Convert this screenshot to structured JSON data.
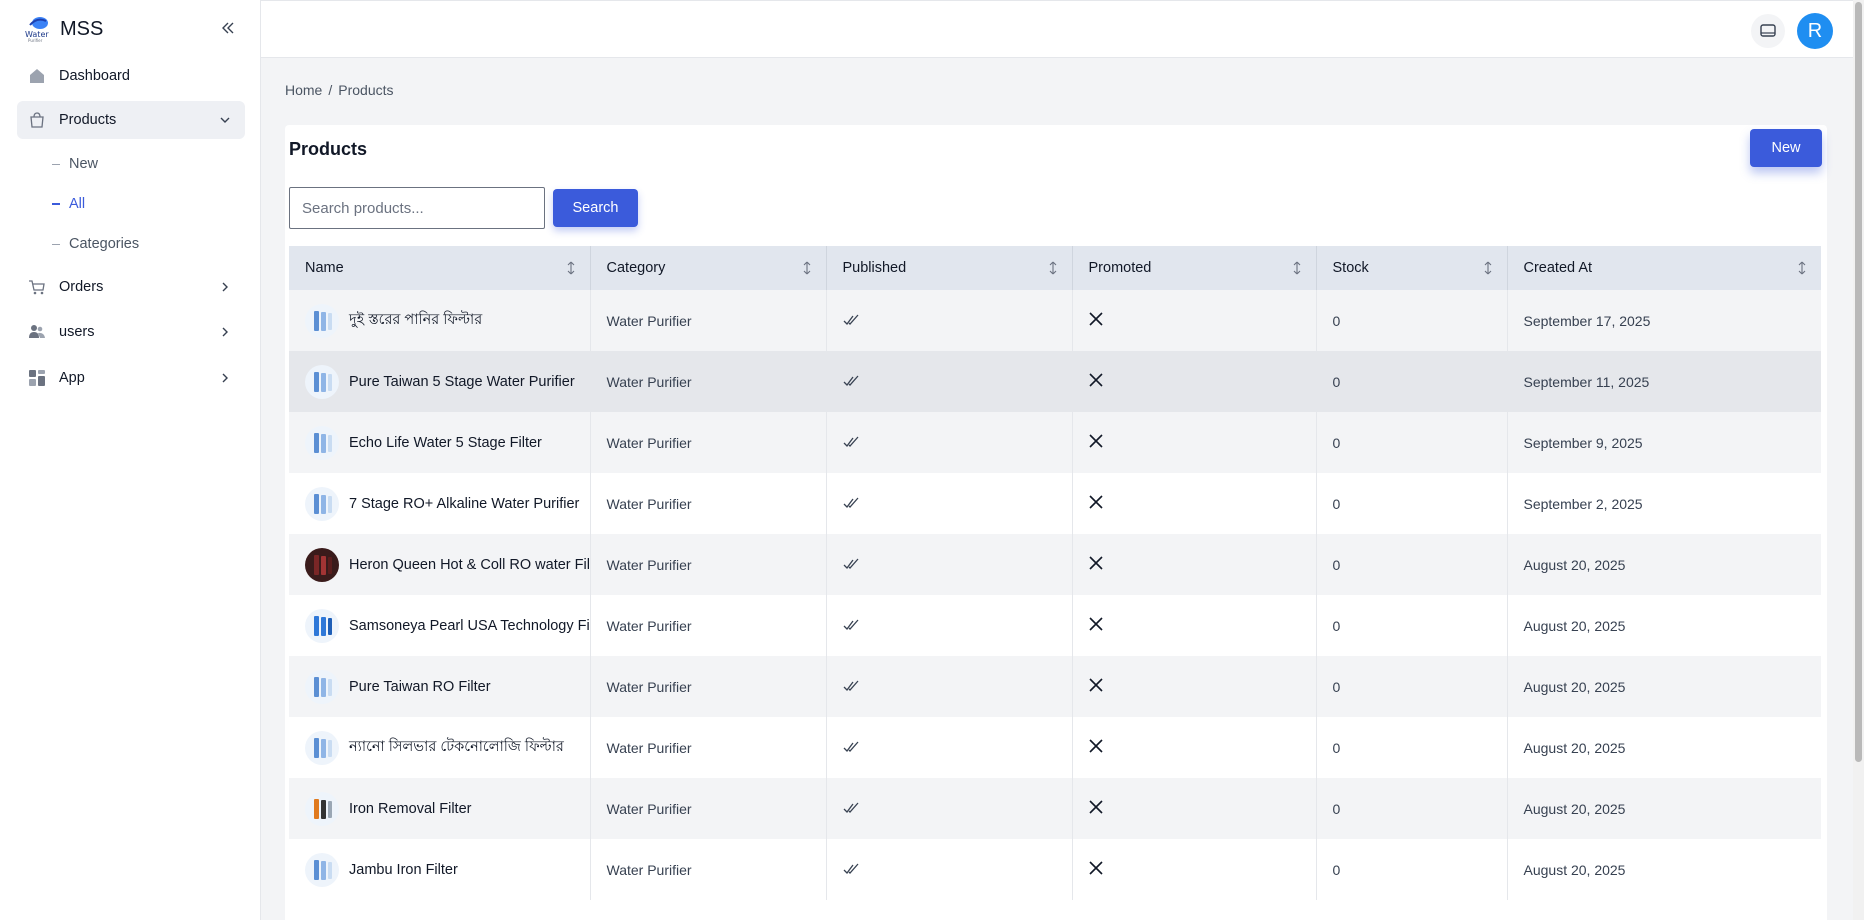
{
  "app": {
    "name": "MSS"
  },
  "sidebar": {
    "items": [
      {
        "label": "Dashboard",
        "icon": "dashboard-icon"
      },
      {
        "label": "Products",
        "icon": "bag-icon",
        "expanded": true
      },
      {
        "label": "Orders",
        "icon": "cart-icon"
      },
      {
        "label": "users",
        "icon": "users-icon"
      },
      {
        "label": "App",
        "icon": "app-grid-icon"
      }
    ],
    "products_sub": [
      {
        "label": "New"
      },
      {
        "label": "All",
        "current": true
      },
      {
        "label": "Categories"
      }
    ]
  },
  "topbar": {
    "avatar_initial": "R",
    "icon": "monitor-icon"
  },
  "breadcrumb": {
    "home": "Home",
    "separator": "/",
    "current": "Products"
  },
  "card": {
    "title": "Products",
    "new_label": "New"
  },
  "search": {
    "placeholder": "Search products...",
    "value": "",
    "button_label": "Search"
  },
  "table": {
    "columns": [
      "Name",
      "Category",
      "Published",
      "Promoted",
      "Stock",
      "Created At"
    ],
    "rows": [
      {
        "name": "দুই স্তরের পানির ফিল্টার",
        "category": "Water Purifier",
        "published": true,
        "promoted": false,
        "stock": "0",
        "created": "September 17, 2025"
      },
      {
        "name": "Pure Taiwan 5 Stage Water Purifier",
        "category": "Water Purifier",
        "published": true,
        "promoted": false,
        "stock": "0",
        "created": "September 11, 2025"
      },
      {
        "name": "Echo Life Water 5 Stage Filter",
        "category": "Water Purifier",
        "published": true,
        "promoted": false,
        "stock": "0",
        "created": "September 9, 2025"
      },
      {
        "name": "7 Stage RO+ Alkaline Water Purifier",
        "category": "Water Purifier",
        "published": true,
        "promoted": false,
        "stock": "0",
        "created": "September 2, 2025"
      },
      {
        "name": "Heron Queen Hot & Coll RO water Fil",
        "category": "Water Purifier",
        "published": true,
        "promoted": false,
        "stock": "0",
        "created": "August 20, 2025"
      },
      {
        "name": "Samsoneya Pearl USA Technology Fil",
        "category": "Water Purifier",
        "published": true,
        "promoted": false,
        "stock": "0",
        "created": "August 20, 2025"
      },
      {
        "name": "Pure Taiwan RO Filter",
        "category": "Water Purifier",
        "published": true,
        "promoted": false,
        "stock": "0",
        "created": "August 20, 2025"
      },
      {
        "name": "ন্যানো সিলভার টেকনোলোজি ফিল্টার",
        "category": "Water Purifier",
        "published": true,
        "promoted": false,
        "stock": "0",
        "created": "August 20, 2025"
      },
      {
        "name": "Iron Removal Filter",
        "category": "Water Purifier",
        "published": true,
        "promoted": false,
        "stock": "0",
        "created": "August 20, 2025"
      },
      {
        "name": "Jambu Iron Filter",
        "category": "Water Purifier",
        "published": true,
        "promoted": false,
        "stock": "0",
        "created": "August 20, 2025"
      }
    ]
  },
  "colors": {
    "accent": "#3b5bdb",
    "avatar": "#1f8ef1",
    "header_bg": "#e1e6ee"
  }
}
